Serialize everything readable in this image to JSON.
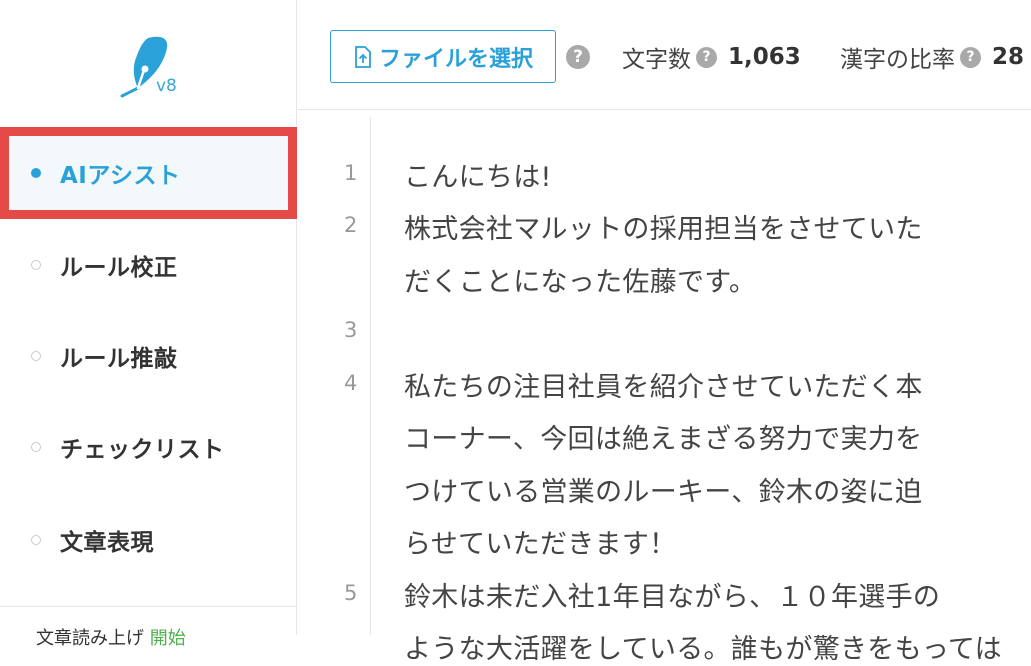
{
  "logo": {
    "version": "v8"
  },
  "sidebar": {
    "items": [
      {
        "label": "AIアシスト",
        "active": true
      },
      {
        "label": "ルール校正",
        "active": false
      },
      {
        "label": "ルール推敲",
        "active": false
      },
      {
        "label": "チェックリスト",
        "active": false
      },
      {
        "label": "文章表現",
        "active": false
      }
    ],
    "partial_text": "文章読み上げ",
    "partial_link": "開始"
  },
  "toolbar": {
    "file_button_label": "ファイルを選択",
    "char_count_label": "文字数",
    "char_count_value": "1,063",
    "kanji_ratio_label": "漢字の比率",
    "kanji_ratio_value": "28"
  },
  "editor": {
    "line_numbers": [
      "1",
      "2",
      "3",
      "4",
      "5"
    ],
    "lines": [
      "こんにちは!",
      "株式会社マルットの採用担当をさせていた",
      "だくことになった佐藤です。",
      "私たちの注目社員を紹介させていただく本",
      "コーナー、今回は絶えまざる努力で実力を",
      "つけている営業のルーキー、鈴木の姿に迫",
      "らせていただきます！",
      "鈴木は未だ入社1年目ながら、１０年選手の",
      "ような大活躍をしている。誰もが驚きをもっては"
    ]
  },
  "colors": {
    "accent": "#2aa1d8",
    "highlight": "#e54b46",
    "link": "#4bb04b"
  },
  "icons": {
    "logo": "quill-leaf-icon",
    "file": "file-upload-icon",
    "help": "question-circle-icon"
  }
}
